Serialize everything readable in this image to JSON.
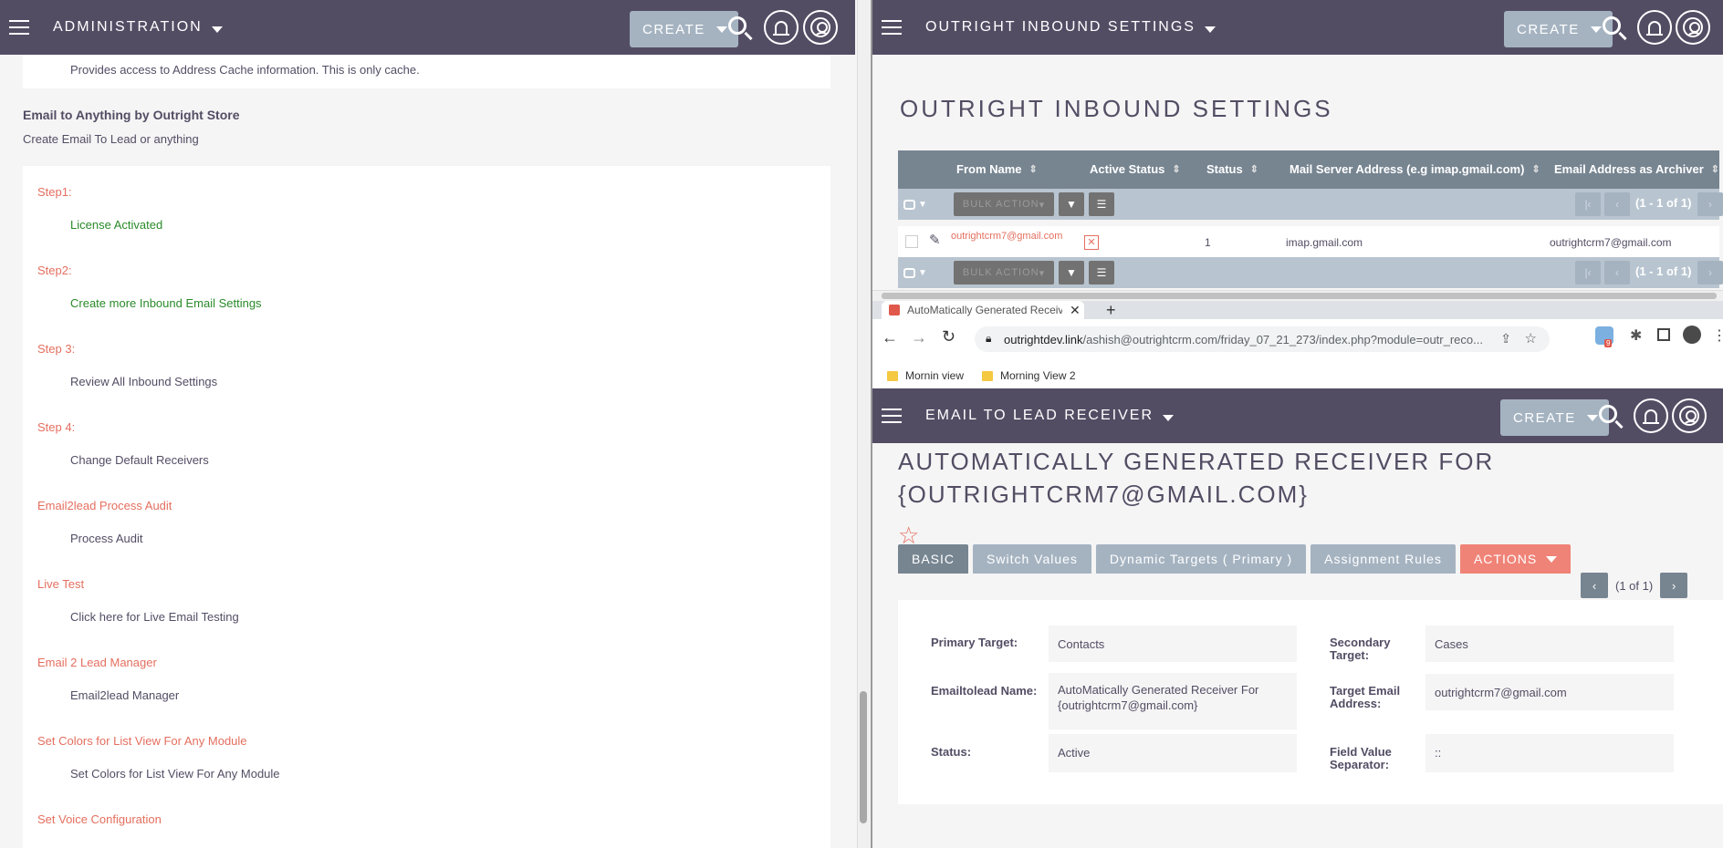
{
  "left": {
    "module_title": "ADMINISTRATION",
    "create_label": "CREATE",
    "address_cache_desc": "Provides access to Address Cache information. This is only cache.",
    "section_title": "Email to Anything by Outright Store",
    "section_sub": "Create Email To Lead or anything",
    "steps": [
      {
        "title": "Step1:",
        "link": "License Activated"
      },
      {
        "title": "Step2:",
        "link": "Create more Inbound Email Settings"
      },
      {
        "title": "Step 3:",
        "link": "Review All Inbound Settings"
      },
      {
        "title": "Step 4:",
        "link": "Change Default Receivers"
      },
      {
        "title": "Email2lead Process Audit",
        "link": "Process Audit"
      },
      {
        "title": "Live Test",
        "link": "Click here for Live Email Testing"
      },
      {
        "title": "Email 2 Lead Manager",
        "link": "Email2lead Manager"
      },
      {
        "title": "Set Colors for List View For Any Module",
        "link": "Set Colors for List View For Any Module"
      },
      {
        "title": "Set Voice Configuration",
        "link": ""
      }
    ]
  },
  "inbound": {
    "module_title": "OUTRIGHT INBOUND SETTINGS",
    "create_label": "CREATE",
    "page_title": "OUTRIGHT INBOUND SETTINGS",
    "columns": [
      "From Name",
      "Active Status",
      "Status",
      "Mail Server Address (e.g imap.gmail.com)",
      "Email Address as Archiver"
    ],
    "bulk_action": "BULK ACTION",
    "pagination": "(1 - 1 of 1)",
    "row": {
      "from_name": "outrightcrm7@gmail.com",
      "status": "1",
      "server": "imap.gmail.com",
      "archiver": "outrightcrm7@gmail.com"
    }
  },
  "browser": {
    "tab_title": "AutoMatically Generated Receive",
    "url_host": "outrightdev.link",
    "url_path": "/ashish@outrightcrm.com/friday_07_21_273/index.php?module=outr_reco...",
    "bookmarks": [
      "Mornin view",
      "Morning View 2"
    ],
    "ext_badge": "9"
  },
  "receiver": {
    "module_title": "EMAIL TO LEAD RECEIVER",
    "create_label": "CREATE",
    "title_line1": "AUTOMATICALLY GENERATED RECEIVER FOR",
    "title_line2": "{OUTRIGHTCRM7@GMAIL.COM}",
    "tabs": [
      "BASIC",
      "Switch Values",
      "Dynamic Targets ( Primary )",
      "Assignment Rules",
      "ACTIONS"
    ],
    "pager_text": "(1 of 1)",
    "fields": {
      "primary_target_label": "Primary Target:",
      "primary_target": "Contacts",
      "secondary_target_label_1": "Secondary",
      "secondary_target_label_2": "Target:",
      "secondary_target": "Cases",
      "name_label": "Emailtolead Name:",
      "name_line1": "AutoMatically Generated Receiver For",
      "name_line2": "{outrightcrm7@gmail.com}",
      "target_email_label_1": "Target Email",
      "target_email_label_2": "Address:",
      "target_email": "outrightcrm7@gmail.com",
      "status_label": "Status:",
      "status": "Active",
      "separator_label_1": "Field Value",
      "separator_label_2": "Separator:",
      "separator": "::"
    }
  }
}
